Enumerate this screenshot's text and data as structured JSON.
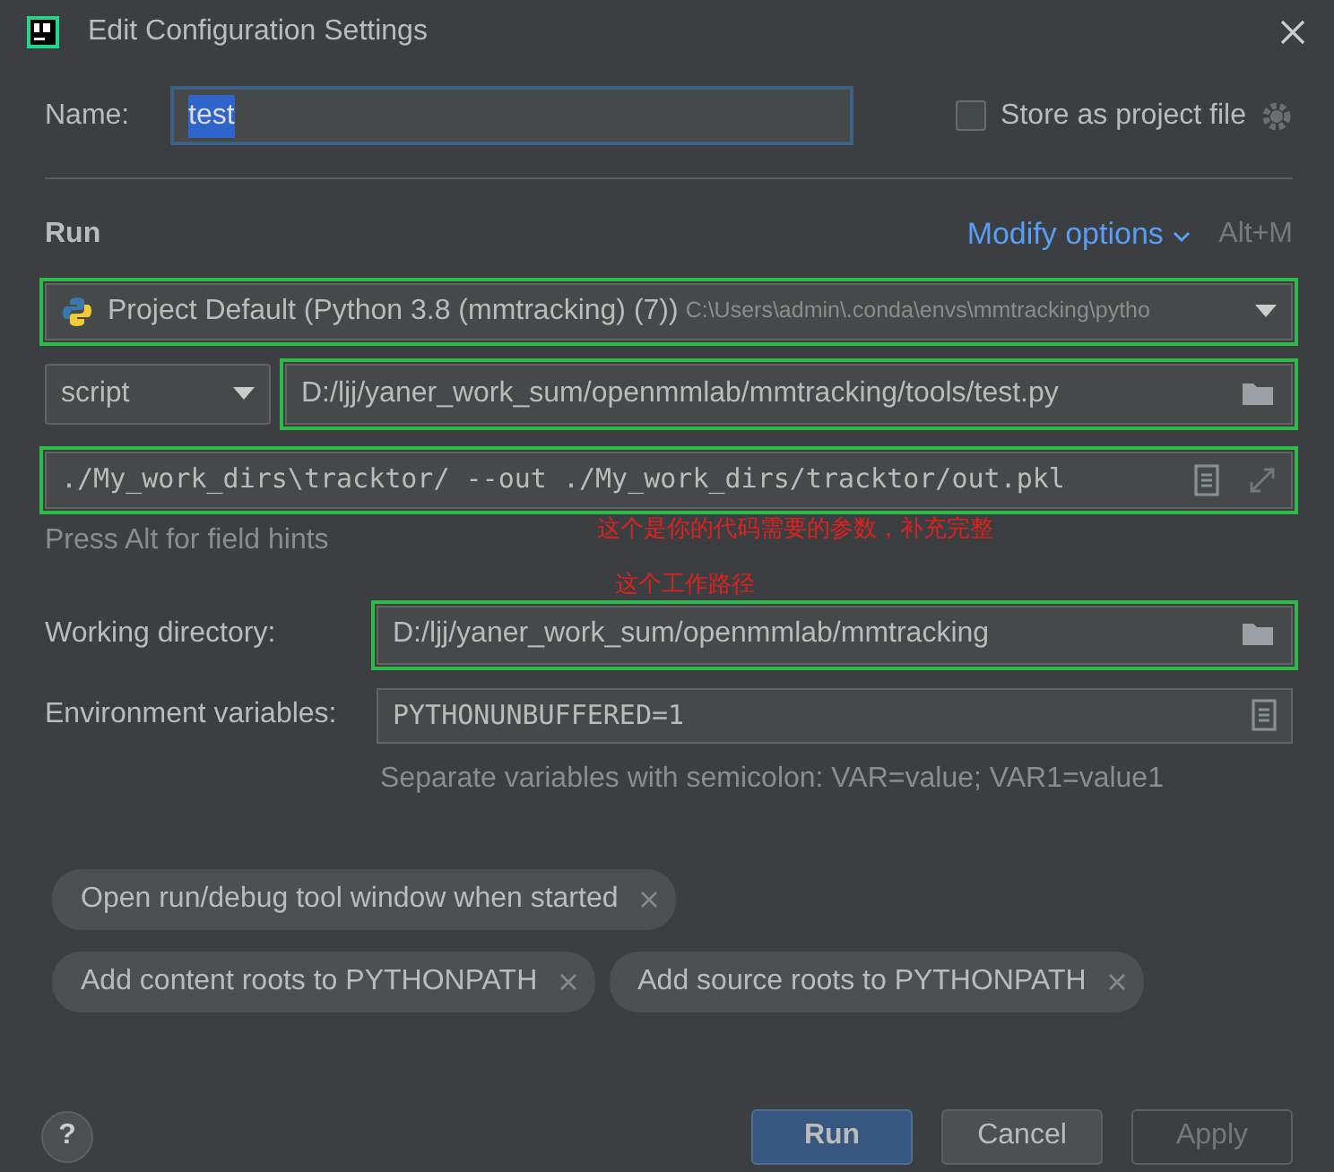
{
  "window": {
    "title": "Edit Configuration Settings"
  },
  "name": {
    "label": "Name:",
    "value": "test",
    "selected_text": true
  },
  "store_as_project_file": {
    "label": "Store as project file",
    "checked": false
  },
  "run_section": {
    "title": "Run",
    "modify_options": "Modify options",
    "shortcut": "Alt+M"
  },
  "interpreter": {
    "value": "Project Default (Python 3.8 (mmtracking) (7))",
    "path": "C:\\Users\\admin\\.conda\\envs\\mmtracking\\pytho",
    "highlighted": true
  },
  "target_type": {
    "value": "script"
  },
  "script_path": {
    "value": "D:/ljj/yaner_work_sum/openmmlab/mmtracking/tools/test.py",
    "highlighted": true
  },
  "parameters": {
    "value": "./My_work_dirs\\tracktor/ --out ./My_work_dirs/tracktor/out.pkl",
    "highlighted": true
  },
  "field_hint": "Press Alt for field hints",
  "working_directory": {
    "label": "Working directory:",
    "value": "D:/ljj/yaner_work_sum/openmmlab/mmtracking",
    "highlighted": true
  },
  "environment_variables": {
    "label": "Environment variables:",
    "value": "PYTHONUNBUFFERED=1",
    "hint": "Separate variables with semicolon: VAR=value; VAR1=value1"
  },
  "annotations": [
    "这个是你的代码需要的参数，补充完整",
    "这个工作路径"
  ],
  "options": [
    [
      "Open run/debug tool window when started"
    ],
    [
      "Add content roots to PYTHONPATH",
      "Add source roots to PYTHONPATH"
    ]
  ],
  "buttons": [
    {
      "label": "Run",
      "kind": "primary",
      "disabled": false
    },
    {
      "label": "Cancel",
      "kind": "normal",
      "disabled": false
    },
    {
      "label": "Apply",
      "kind": "normal",
      "disabled": true
    }
  ],
  "help": "?"
}
